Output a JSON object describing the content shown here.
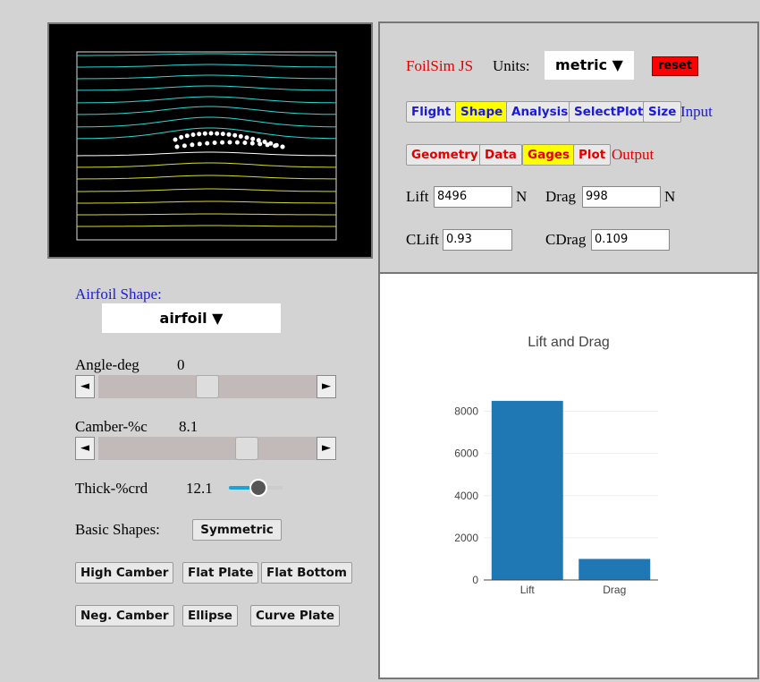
{
  "header": {
    "app_title": "FoilSim JS",
    "units_label": "Units:",
    "units_value": "metric ▼",
    "reset_label": "reset"
  },
  "input_tabs": {
    "items": [
      "Flight",
      "Shape",
      "Analysis",
      "SelectPlot",
      "Size"
    ],
    "active": "Shape",
    "suffix": "Input"
  },
  "output_tabs": {
    "items": [
      "Geometry",
      "Data",
      "Gages",
      "Plot"
    ],
    "active": "Gages",
    "suffix": "Output"
  },
  "results": {
    "lift_label": "Lift",
    "lift_value": "8496",
    "lift_unit": "N",
    "drag_label": "Drag",
    "drag_value": "998",
    "drag_unit": "N",
    "clift_label": "CLift",
    "clift_value": "0.93",
    "cdrag_label": "CDrag",
    "cdrag_value": "0.109"
  },
  "shape_panel": {
    "airfoil_shape_label": "Airfoil Shape:",
    "airfoil_shape_value": "airfoil ▼",
    "angle_label": "Angle-deg",
    "angle_value": "0",
    "angle_level": 0.5,
    "camber_label": "Camber-%c",
    "camber_value": "8.1",
    "camber_level": 0.7,
    "thick_label": "Thick-%crd",
    "thick_value": "12.1",
    "thick_level": 0.55,
    "left_arrow": "◄",
    "right_arrow": "►",
    "basic_shapes_label": "Basic Shapes:",
    "buttons": {
      "symmetric": "Symmetric",
      "high_camber": "High Camber",
      "flat_plate": "Flat Plate",
      "flat_bottom": "Flat Bottom",
      "neg_camber": "Neg. Camber",
      "ellipse": "Ellipse",
      "curve_plate": "Curve Plate"
    }
  },
  "colors": {
    "streamline_upper": "#2fd6d6",
    "streamline_lower": "#d8d830",
    "bar": "#1f77b4",
    "title_red": "#e00000",
    "label_blue": "#1a1adb",
    "active_tab": "#ffff00"
  },
  "chart_data": {
    "type": "bar",
    "title": "Lift and Drag",
    "categories": [
      "Lift",
      "Drag"
    ],
    "values": [
      8496,
      998
    ],
    "ylim": [
      0,
      9000
    ],
    "yticks": [
      0,
      2000,
      4000,
      6000,
      8000
    ],
    "ytick_labels": [
      "0",
      "2000",
      "4000",
      "6000",
      "8000"
    ],
    "grid": true
  }
}
